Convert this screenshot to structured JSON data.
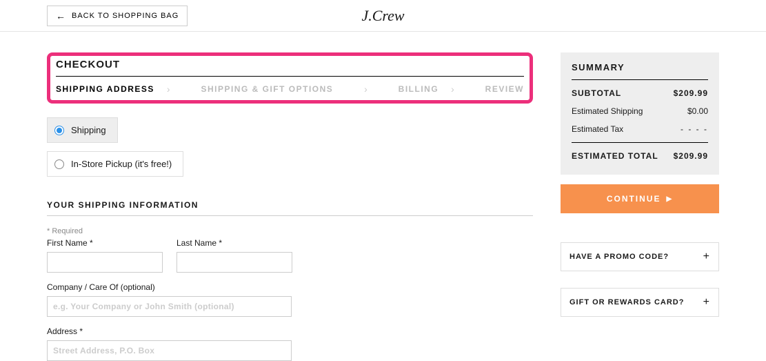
{
  "header": {
    "back_label": "BACK TO SHOPPING BAG",
    "logo": "J.Crew"
  },
  "checkout": {
    "title": "CHECKOUT",
    "steps": [
      "SHIPPING ADDRESS",
      "SHIPPING & GIFT OPTIONS",
      "BILLING",
      "REVIEW"
    ]
  },
  "delivery": {
    "shipping_label": "Shipping",
    "pickup_label": "In-Store Pickup (it's free!)"
  },
  "form": {
    "section_title": "YOUR SHIPPING INFORMATION",
    "required_note": "* Required",
    "first_name_label": "First Name *",
    "last_name_label": "Last Name *",
    "company_label": "Company / Care Of (optional)",
    "company_placeholder": "e.g. Your Company or John Smith (optional)",
    "address_label": "Address *",
    "address_placeholder": "Street Address, P.O. Box"
  },
  "summary": {
    "title": "SUMMARY",
    "subtotal_label": "SUBTOTAL",
    "subtotal_value": "$209.99",
    "shipping_label": "Estimated Shipping",
    "shipping_value": "$0.00",
    "tax_label": "Estimated Tax",
    "tax_value": "- - - -",
    "total_label": "ESTIMATED TOTAL",
    "total_value": "$209.99",
    "continue_label": "CONTINUE"
  },
  "promos": {
    "promo_label": "HAVE A PROMO CODE?",
    "gift_label": "GIFT OR REWARDS CARD?"
  }
}
